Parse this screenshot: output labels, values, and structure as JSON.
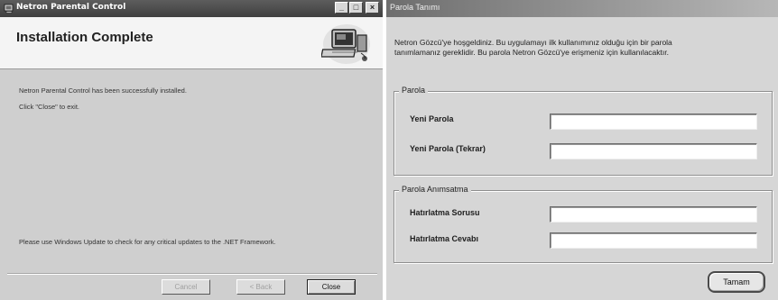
{
  "left_window": {
    "title": "Netron Parental Control",
    "caption_buttons": {
      "minimize": "_",
      "maximize": "□",
      "close": "×"
    },
    "header": {
      "heading": "Installation Complete",
      "illustration": "computer-setup-illustration"
    },
    "body": {
      "line1": "Netron Parental Control has been successfully installed.",
      "line2": "Click \"Close\" to exit.",
      "footer_note": "Please use Windows Update to check for any critical updates to the .NET Framework."
    },
    "buttons": {
      "cancel": "Cancel",
      "back": "< Back",
      "close": "Close"
    }
  },
  "right_window": {
    "title": "Parola Tanımı",
    "intro_line1": "Netron Gözcü'ye hoşgeldiniz. Bu uygulamayı ilk kullanımınız olduğu için bir parola",
    "intro_line2": "tanımlamanız gereklidir. Bu parola Netron Gözcü'ye erişmeniz için kullanılacaktır.",
    "password_group": {
      "label": "Parola",
      "new_password_label": "Yeni Parola",
      "new_password_value": "",
      "repeat_password_label": "Yeni Parola (Tekrar)",
      "repeat_password_value": ""
    },
    "reminder_group": {
      "label": "Parola Anımsatma",
      "question_label": "Hatırlatma Sorusu",
      "question_value": "",
      "answer_label": "Hatırlatma Cevabı",
      "answer_value": ""
    },
    "ok_button": "Tamam"
  },
  "icons": [
    "app-icon",
    "minimize-icon",
    "maximize-icon",
    "close-icon",
    "computer-setup-illustration"
  ]
}
